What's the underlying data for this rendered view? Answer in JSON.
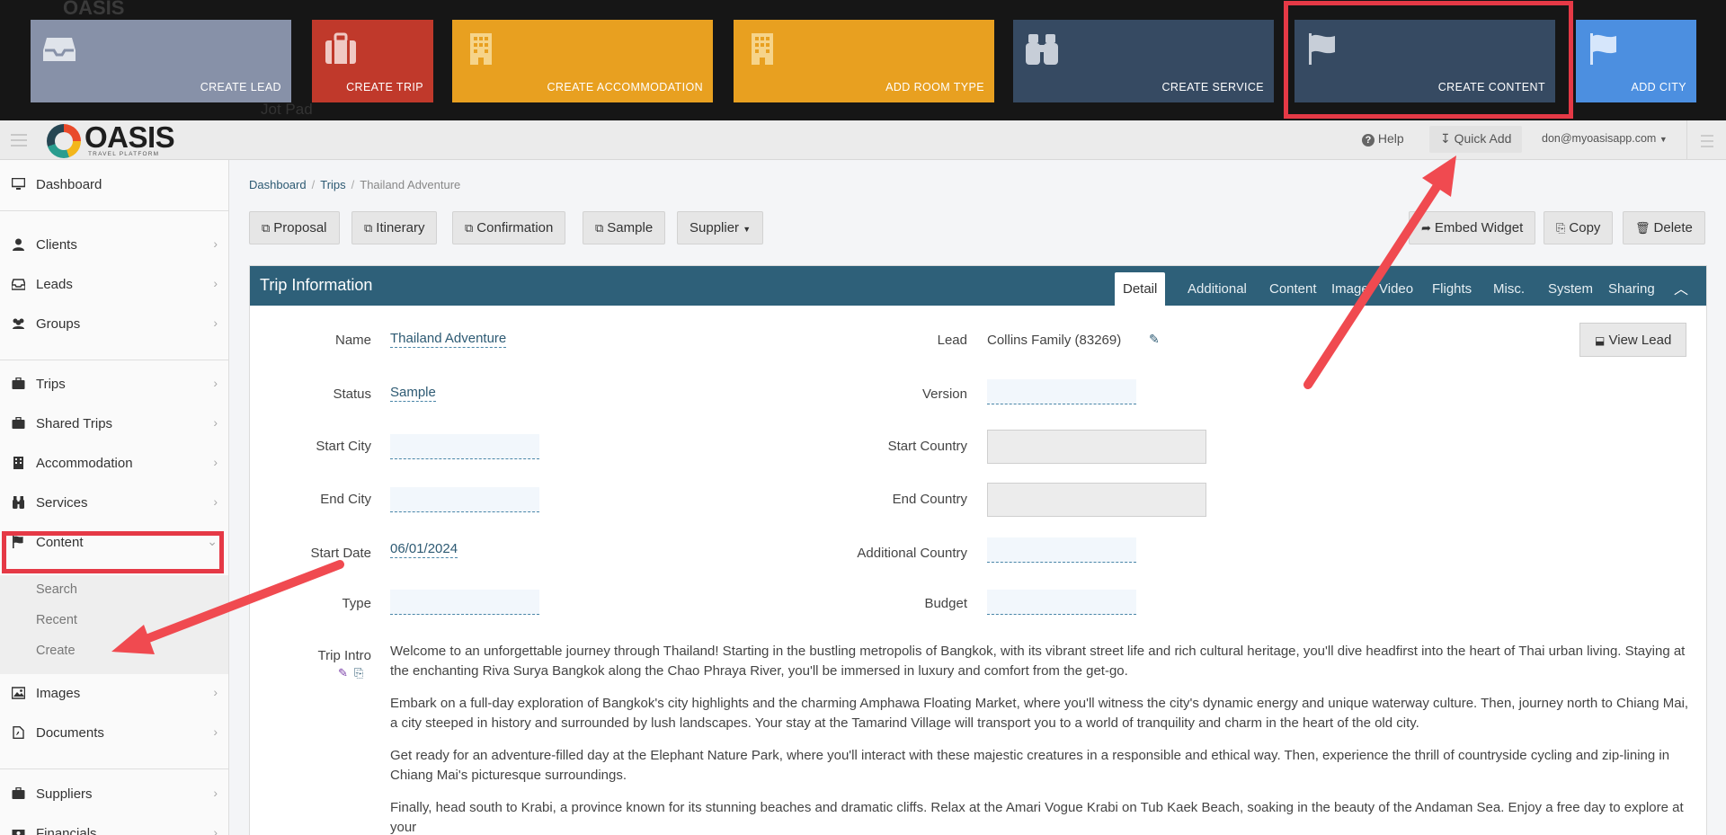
{
  "quick_add": {
    "tiles": [
      {
        "label": "CREATE LEAD",
        "icon": "inbox-icon",
        "color": "#8791a8"
      },
      {
        "label": "CREATE TRIP",
        "icon": "suitcase-icon",
        "color": "#c0392b"
      },
      {
        "label": "CREATE ACCOMMODATION",
        "icon": "building-icon",
        "color": "#e8a020"
      },
      {
        "label": "ADD ROOM TYPE",
        "icon": "building-icon",
        "color": "#e8a020"
      },
      {
        "label": "CREATE SERVICE",
        "icon": "binoculars-icon",
        "color": "#364a62"
      },
      {
        "label": "CREATE CONTENT",
        "icon": "flag-icon",
        "color": "#364a62"
      },
      {
        "label": "ADD CITY",
        "icon": "flag-icon",
        "color": "#4c8fe0"
      }
    ],
    "background_text": {
      "jot_pad": "Jot Pad"
    }
  },
  "topbar": {
    "logo_text": "OASIS",
    "logo_sub": "TRAVEL PLATFORM",
    "help": "Help",
    "quick_add": "Quick Add",
    "user": "don@myoasisapp.com"
  },
  "sidebar": {
    "items": [
      {
        "label": "Dashboard",
        "icon": "monitor-icon"
      },
      {
        "label": "Clients",
        "icon": "user-icon"
      },
      {
        "label": "Leads",
        "icon": "inbox-icon"
      },
      {
        "label": "Groups",
        "icon": "users-icon"
      },
      {
        "label": "Trips",
        "icon": "suitcase-icon"
      },
      {
        "label": "Shared Trips",
        "icon": "suitcase-icon"
      },
      {
        "label": "Accommodation",
        "icon": "building-icon"
      },
      {
        "label": "Services",
        "icon": "binoculars-icon"
      },
      {
        "label": "Content",
        "icon": "flag-icon"
      },
      {
        "label": "Images",
        "icon": "image-icon"
      },
      {
        "label": "Documents",
        "icon": "document-icon"
      },
      {
        "label": "Suppliers",
        "icon": "suitcase-icon"
      },
      {
        "label": "Financials",
        "icon": "money-icon"
      }
    ],
    "content_sub": [
      "Search",
      "Recent",
      "Create"
    ]
  },
  "breadcrumb": [
    "Dashboard",
    "Trips",
    "Thailand Adventure"
  ],
  "actions": {
    "proposal": "Proposal",
    "itinerary": "Itinerary",
    "confirmation": "Confirmation",
    "sample": "Sample",
    "supplier": "Supplier",
    "embed_widget": "Embed Widget",
    "copy": "Copy",
    "delete": "Delete"
  },
  "panel": {
    "title": "Trip Information",
    "tabs": [
      "Detail",
      "Additional",
      "Content",
      "Image",
      "Video",
      "Flights",
      "Misc.",
      "System",
      "Sharing"
    ],
    "active_tab": "Detail"
  },
  "fields": {
    "name_label": "Name",
    "name_value": "Thailand Adventure",
    "status_label": "Status",
    "status_value": "Sample",
    "start_city_label": "Start City",
    "end_city_label": "End City",
    "start_date_label": "Start Date",
    "start_date_value": "06/01/2024",
    "type_label": "Type",
    "lead_label": "Lead",
    "lead_value": "Collins Family (83269)",
    "version_label": "Version",
    "start_country_label": "Start Country",
    "end_country_label": "End Country",
    "additional_country_label": "Additional Country",
    "budget_label": "Budget",
    "view_lead": "View Lead",
    "trip_intro_label": "Trip Intro"
  },
  "trip_intro": [
    "Welcome to an unforgettable journey through Thailand! Starting in the bustling metropolis of Bangkok, with its vibrant street life and rich cultural heritage, you'll dive headfirst into the heart of Thai urban living. Staying at the enchanting Riva Surya Bangkok along the Chao Phraya River, you'll be immersed in luxury and comfort from the get-go.",
    "Embark on a full-day exploration of Bangkok's city highlights and the charming Amphawa Floating Market, where you'll witness the city's dynamic energy and unique waterway culture. Then, journey north to Chiang Mai, a city steeped in history and surrounded by lush landscapes. Your stay at the Tamarind Village will transport you to a world of tranquility and charm in the heart of the old city.",
    "Get ready for an adventure-filled day at the Elephant Nature Park, where you'll interact with these majestic creatures in a responsible and ethical way. Then, experience the thrill of countryside cycling and zip-lining in Chiang Mai's picturesque surroundings.",
    "Finally, head south to Krabi, a province known for its stunning beaches and dramatic cliffs. Relax at the Amari Vogue Krabi on Tub Kaek Beach, soaking in the beauty of the Andaman Sea. Enjoy a free day to explore at your"
  ]
}
